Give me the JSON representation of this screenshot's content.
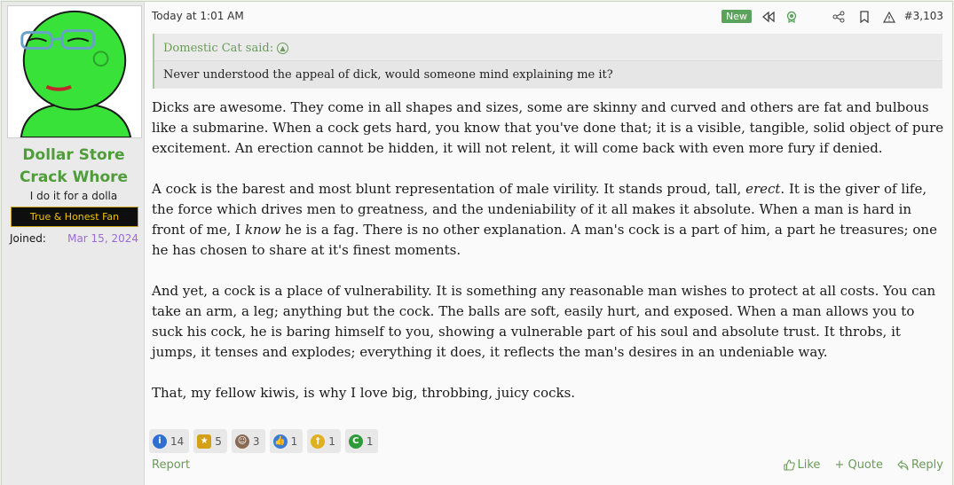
{
  "user": {
    "name": "Dollar Store Crack Whore",
    "title": "I do it for a dolla",
    "banner": "True & Honest Fan",
    "joined_label": "Joined:",
    "joined_value": "Mar 15, 2024"
  },
  "post": {
    "timestamp": "Today at 1:01 AM",
    "new_badge": "New",
    "post_number": "#3,103",
    "quote": {
      "author_line": "Domestic Cat said:",
      "text": "Never understood the appeal of dick, would someone mind explaining me it?"
    },
    "paragraphs": [
      "Dicks are awesome. They come in all shapes and sizes, some are skinny and curved and others are fat and bulbous like a submarine. When a cock gets hard, you know that you've done that; it is a visible, tangible, solid object of pure excitement. An erection cannot be hidden, it will not relent, it will come back with even more fury if denied.",
      "A cock is the barest and most blunt representation of male virility. It stands proud, tall, erect. It is the giver of life, the force which drives men to greatness, and the undeniability of it all makes it absolute. When a man is hard in front of me, I know he is a fag. There is no other explanation. A man's cock is a part of him, a part he treasures; one he has chosen to share at it's finest moments.",
      "And yet, a cock is a place of vulnerability. It is something any reasonable man wishes to protect at all costs. You can take an arm, a leg; anything but the cock. The balls are soft, easily hurt, and exposed. When a man allows you to suck his cock, he is baring himself to you, showing a vulnerable part of his soul and absolute trust. It throbs, it jumps, it tenses and explodes; everything it does, it reflects the man's desires in an undeniable way.",
      "That, my fellow kiwis, is why I love big, throbbing, juicy cocks."
    ],
    "p2_parts": {
      "a": "A cock is the barest and most blunt representation of male virility. It stands proud, tall, ",
      "em1": "erect",
      "b": ". It is the giver of life, the force which drives men to greatness, and the undeniability of it all makes it absolute. When a man is hard in front of me, I ",
      "em2": "know",
      "c": " he is a fag. There is no other explanation. A man's cock is a part of him, a part he treasures; one he has chosen to share at it's finest moments."
    }
  },
  "reactions": [
    {
      "icon": "informative-icon",
      "count": "14",
      "color": "#2f6fd1"
    },
    {
      "icon": "medal-icon",
      "count": "5",
      "color": "#d4a017"
    },
    {
      "icon": "face-icon",
      "count": "3",
      "color": "#8a6a55"
    },
    {
      "icon": "thumbs-up-icon",
      "count": "1",
      "color": "#3a7bd5"
    },
    {
      "icon": "dagger-icon",
      "count": "1",
      "color": "#e0b020"
    },
    {
      "icon": "green-c-icon",
      "count": "1",
      "color": "#2e9a3a"
    }
  ],
  "footer": {
    "report": "Report",
    "like": "Like",
    "quote": "+ Quote",
    "reply": "Reply"
  }
}
